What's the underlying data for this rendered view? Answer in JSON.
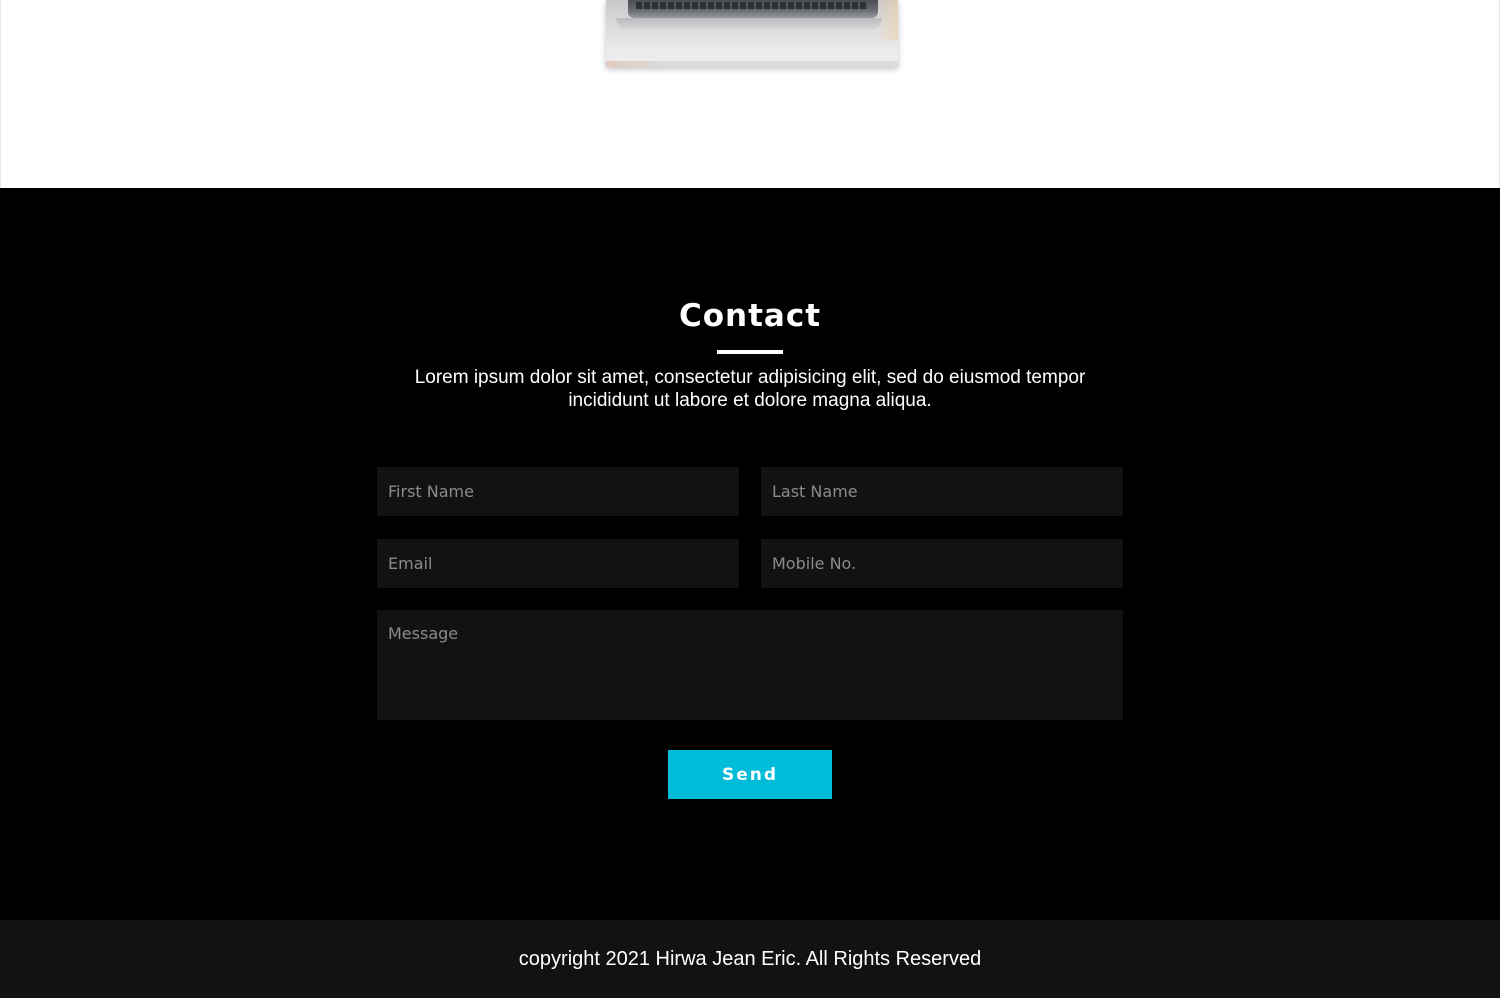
{
  "contact": {
    "title": "Contact",
    "description": "Lorem ipsum dolor sit amet, consectetur adipisicing elit, sed do eiusmod tempor incididunt ut labore et dolore magna aliqua.",
    "form": {
      "first_name_placeholder": "First Name",
      "last_name_placeholder": "Last Name",
      "email_placeholder": "Email",
      "mobile_placeholder": "Mobile No.",
      "message_placeholder": "Message",
      "send_label": "Send"
    }
  },
  "footer": {
    "copyright": "copyright 2021 Hirwa Jean Eric. All Rights Reserved"
  },
  "colors": {
    "accent": "#00bcd8",
    "section_bg": "#000000",
    "field_bg": "#121212",
    "footer_bg": "#121212"
  }
}
